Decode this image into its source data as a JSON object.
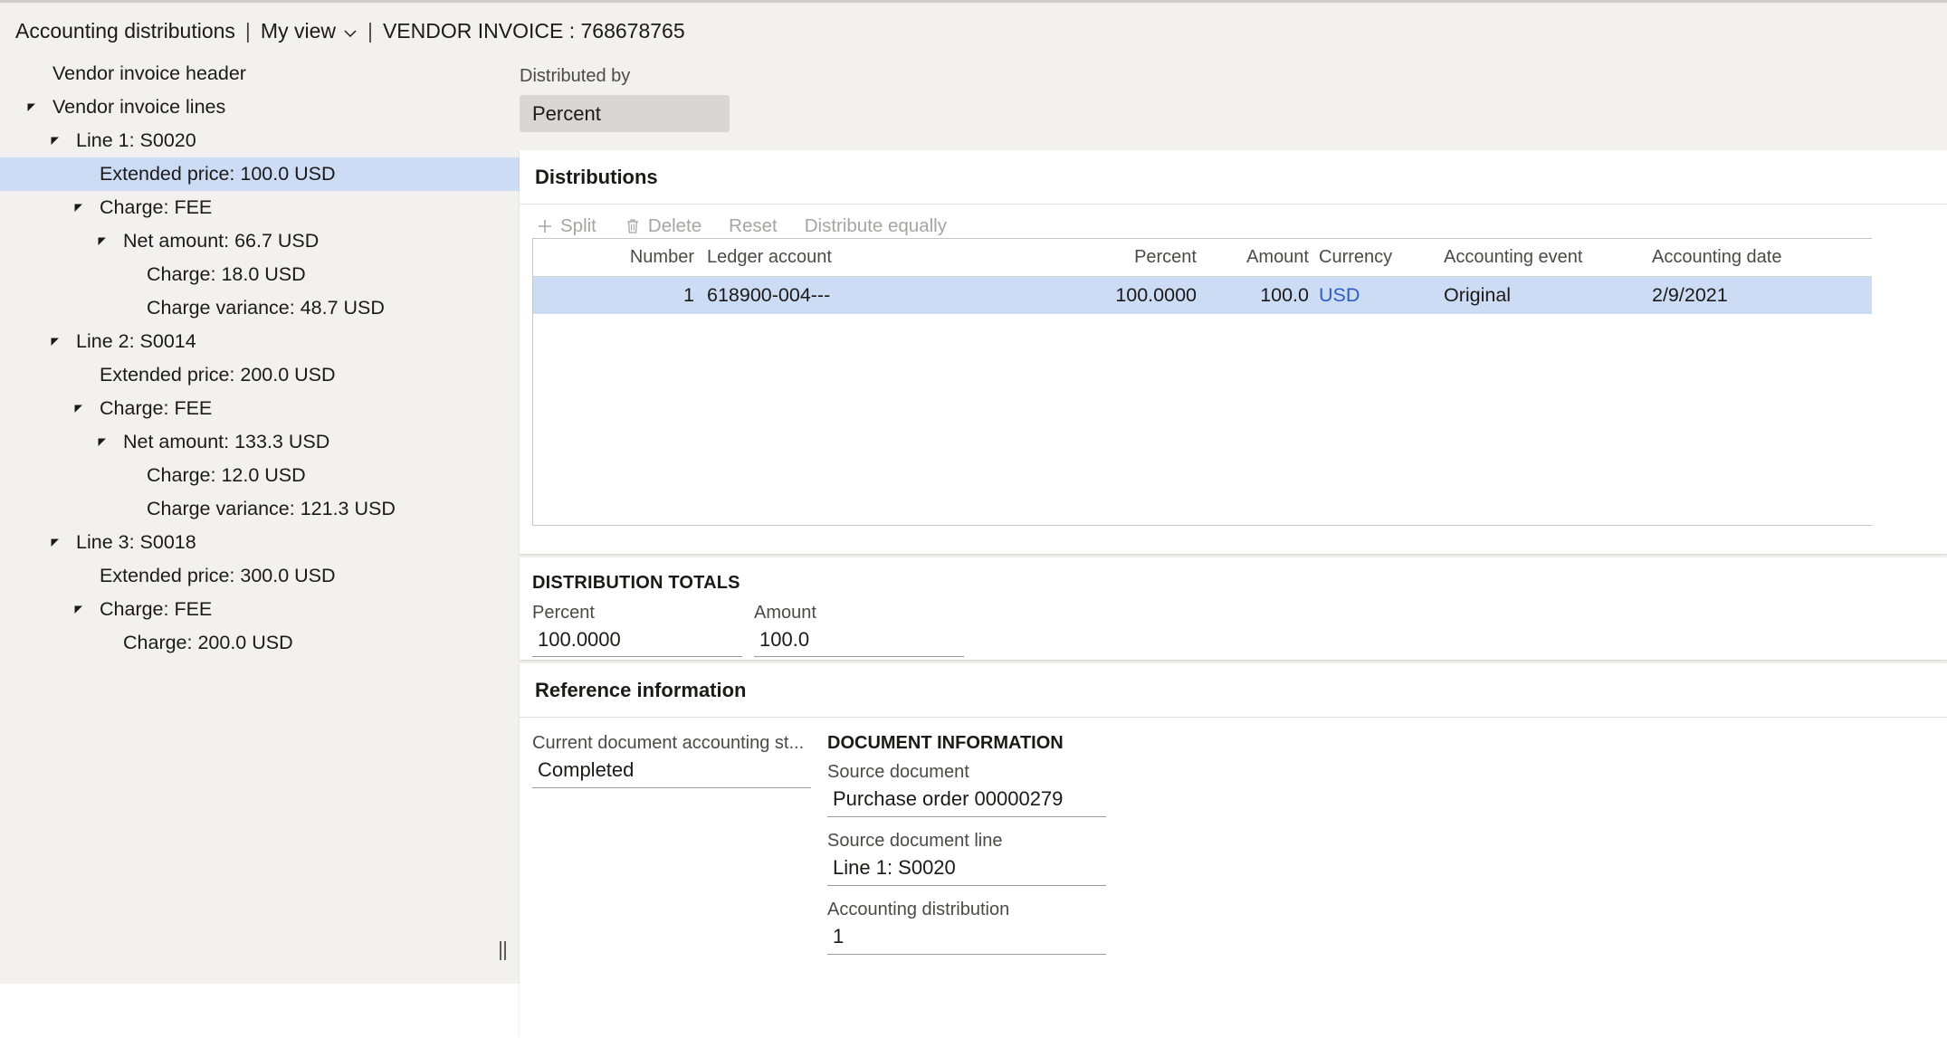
{
  "header": {
    "breadcrumb_page": "Accounting distributions",
    "sep1": "|",
    "view_label": "My view",
    "sep2": "|",
    "record_title": "VENDOR INVOICE : 768678765",
    "chevron_icon": "chevron-down-icon"
  },
  "tree": {
    "items": [
      {
        "label": "Vendor invoice header",
        "indent": 0,
        "arrow": "none",
        "selected": false
      },
      {
        "label": "Vendor invoice lines",
        "indent": 0,
        "arrow": "expanded",
        "selected": false
      },
      {
        "label": "Line 1: S0020",
        "indent": 1,
        "arrow": "expanded",
        "selected": false
      },
      {
        "label": "Extended price: 100.0 USD",
        "indent": 2,
        "arrow": "none",
        "selected": true
      },
      {
        "label": "Charge: FEE",
        "indent": 2,
        "arrow": "expanded",
        "selected": false
      },
      {
        "label": "Net amount: 66.7 USD",
        "indent": 3,
        "arrow": "expanded",
        "selected": false
      },
      {
        "label": "Charge: 18.0 USD",
        "indent": 4,
        "arrow": "none",
        "selected": false
      },
      {
        "label": "Charge variance: 48.7 USD",
        "indent": 4,
        "arrow": "none",
        "selected": false
      },
      {
        "label": "Line 2: S0014",
        "indent": 1,
        "arrow": "expanded",
        "selected": false
      },
      {
        "label": "Extended price: 200.0 USD",
        "indent": 2,
        "arrow": "none",
        "selected": false
      },
      {
        "label": "Charge: FEE",
        "indent": 2,
        "arrow": "expanded",
        "selected": false
      },
      {
        "label": "Net amount: 133.3 USD",
        "indent": 3,
        "arrow": "expanded",
        "selected": false
      },
      {
        "label": "Charge: 12.0 USD",
        "indent": 4,
        "arrow": "none",
        "selected": false
      },
      {
        "label": "Charge variance: 121.3 USD",
        "indent": 4,
        "arrow": "none",
        "selected": false
      },
      {
        "label": "Line 3: S0018",
        "indent": 1,
        "arrow": "expanded",
        "selected": false
      },
      {
        "label": "Extended price: 300.0 USD",
        "indent": 2,
        "arrow": "none",
        "selected": false
      },
      {
        "label": "Charge: FEE",
        "indent": 2,
        "arrow": "expanded",
        "selected": false
      },
      {
        "label": "Charge: 200.0 USD",
        "indent": 3,
        "arrow": "none",
        "selected": false
      }
    ]
  },
  "distributed_by": {
    "label": "Distributed by",
    "value": "Percent"
  },
  "distributions": {
    "title": "Distributions",
    "toolbar": [
      {
        "label": "Split",
        "icon": "plus-icon",
        "disabled": true
      },
      {
        "label": "Delete",
        "icon": "trash-icon",
        "disabled": true
      },
      {
        "label": "Reset",
        "icon": "none",
        "disabled": true
      },
      {
        "label": "Distribute equally",
        "icon": "none",
        "disabled": true
      }
    ],
    "columns": [
      "Number",
      "Ledger account",
      "Percent",
      "Amount",
      "Currency",
      "Accounting event",
      "Accounting date"
    ],
    "rows": [
      {
        "number": "1",
        "ledger_account": "618900-004---",
        "percent": "100.0000",
        "amount": "100.0",
        "currency": "USD",
        "accounting_event": "Original",
        "accounting_date": "2/9/2021",
        "selected": true
      }
    ]
  },
  "distribution_totals": {
    "caption": "DISTRIBUTION TOTALS",
    "percent_label": "Percent",
    "percent_value": "100.0000",
    "amount_label": "Amount",
    "amount_value": "100.0"
  },
  "reference_information": {
    "title": "Reference information",
    "status_label": "Current document accounting st...",
    "status_value": "Completed",
    "document_information_caption": "DOCUMENT INFORMATION",
    "source_document_label": "Source document",
    "source_document_value": "Purchase order 00000279",
    "source_document_line_label": "Source document line",
    "source_document_line_value": "Line 1: S0020",
    "accounting_distribution_label": "Accounting distribution",
    "accounting_distribution_value": "1"
  },
  "colors": {
    "selection": "#cddcf5",
    "link": "#2b5ec4",
    "page_bg": "#f2f1f0",
    "card_bg": "#ffffff"
  },
  "splitter": {
    "icon": "vertical-splitter-grip"
  }
}
